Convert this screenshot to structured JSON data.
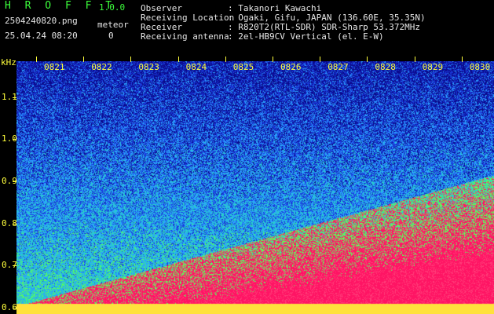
{
  "header": {
    "app_title": "H R O F F T",
    "version": "1.0.0",
    "filename": "2504240820.png",
    "datetime": "25.04.24 08:20",
    "meteor_label": "meteor",
    "meteor_count": "0",
    "info_labels": [
      "Observer",
      "Receiving Location",
      "Receiver",
      "Receiving antenna"
    ],
    "info_values": [
      ": Takanori Kawachi",
      ": Ogaki, Gifu, JAPAN (136.60E, 35.35N)",
      ": R820T2(RTL-SDR) SDR-Sharp 53.372MHz",
      ": 2el-HB9CV Vertical (el. E-W)"
    ]
  },
  "chart_data": {
    "type": "heatmap",
    "ylabel": "kHz",
    "x_ticks": [
      "0821",
      "0822",
      "0823",
      "0824",
      "0825",
      "0826",
      "0827",
      "0828",
      "0829",
      "0830"
    ],
    "y_ticks": [
      "1.1",
      "1.0",
      "0.9",
      "0.8",
      "0.7",
      "0.6"
    ],
    "y_tick_values": [
      1.1,
      1.0,
      0.9,
      0.8,
      0.7,
      0.6
    ],
    "ylim": [
      0.585,
      1.185
    ],
    "palette": [
      "#0a0a8c",
      "#1a3cdc",
      "#2aa0ff",
      "#28d2c8",
      "#5aff5a",
      "#ffe13c",
      "#ff3c78",
      "#ff1464"
    ]
  }
}
